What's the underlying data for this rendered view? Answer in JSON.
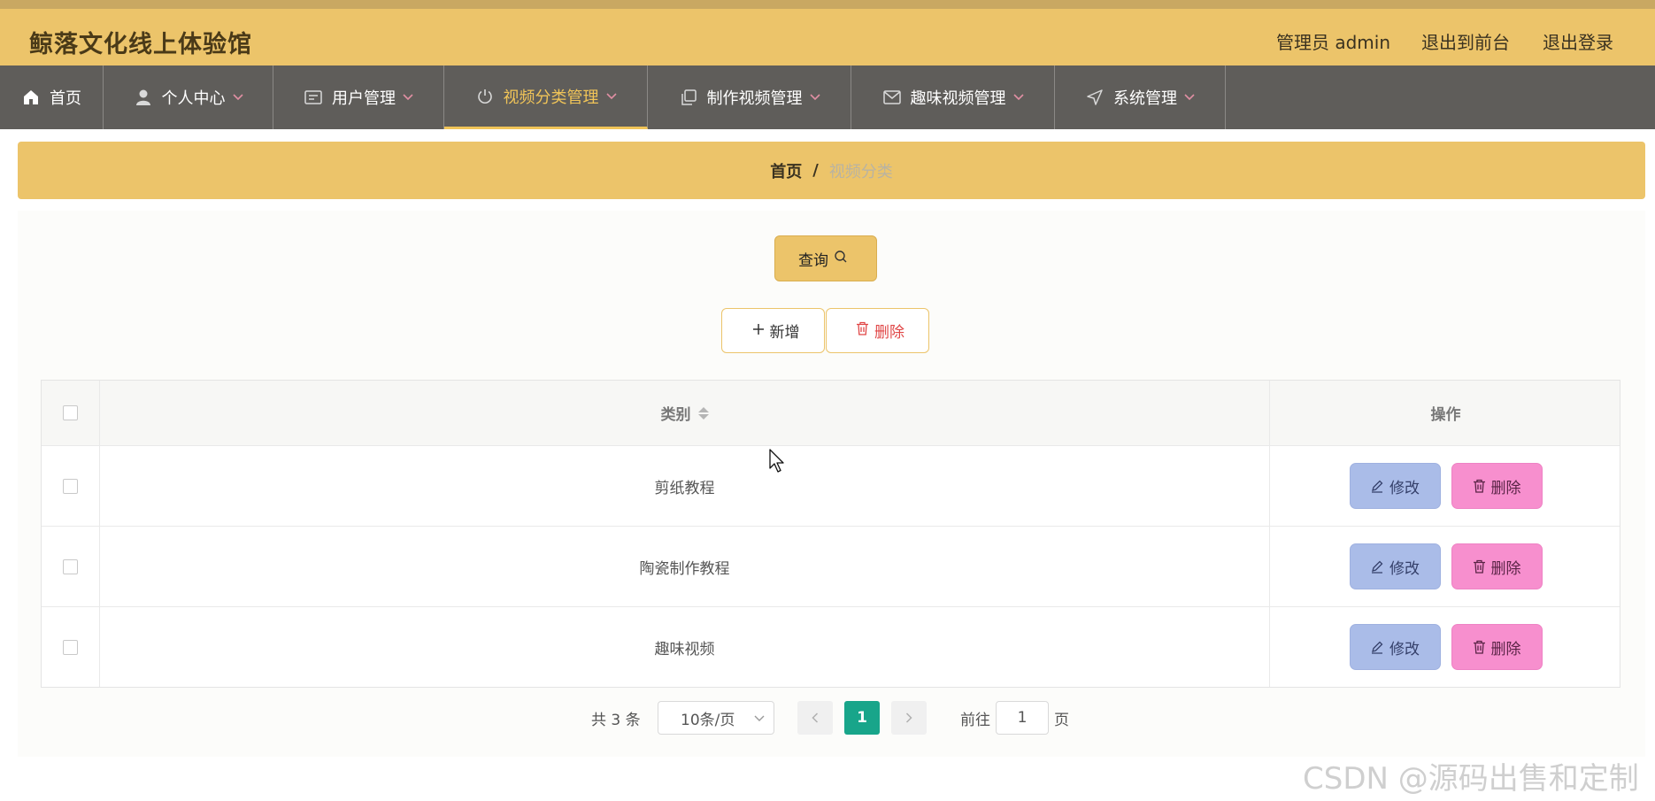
{
  "app": {
    "title": "鲸落文化线上体验馆",
    "user_label": "管理员 admin",
    "to_front_label": "退出到前台",
    "logout_label": "退出登录"
  },
  "nav": {
    "items": [
      {
        "label": "首页",
        "icon": "home-icon"
      },
      {
        "label": "个人中心",
        "icon": "user-icon"
      },
      {
        "label": "用户管理",
        "icon": "id-card-icon"
      },
      {
        "label": "视频分类管理",
        "icon": "power-icon",
        "active": true
      },
      {
        "label": "制作视频管理",
        "icon": "copy-icon"
      },
      {
        "label": "趣味视频管理",
        "icon": "mail-icon"
      },
      {
        "label": "系统管理",
        "icon": "send-icon"
      }
    ]
  },
  "breadcrumb": {
    "home": "首页",
    "separator": "/",
    "current": "视频分类"
  },
  "toolbar": {
    "query_label": "查询",
    "add_label": "新增",
    "delete_label": "删除"
  },
  "table": {
    "columns": [
      "类别",
      "操作"
    ],
    "rows": [
      {
        "category": "剪纸教程"
      },
      {
        "category": "陶瓷制作教程"
      },
      {
        "category": "趣味视频"
      }
    ],
    "edit_label": "修改",
    "delete_label": "删除"
  },
  "pagination": {
    "total_text": "共 3 条",
    "page_size": "10条/页",
    "current_page": "1",
    "goto_label": "前往",
    "goto_value": "1",
    "page_suffix": "页"
  },
  "watermark": "CSDN @源码出售和定制",
  "colors": {
    "header": "#ecc46a",
    "nav": "#5f5d5a",
    "accent": "#f0c458",
    "edit_button": "#aabce8",
    "delete_button": "#f78fce",
    "page_active": "#18a58a"
  }
}
